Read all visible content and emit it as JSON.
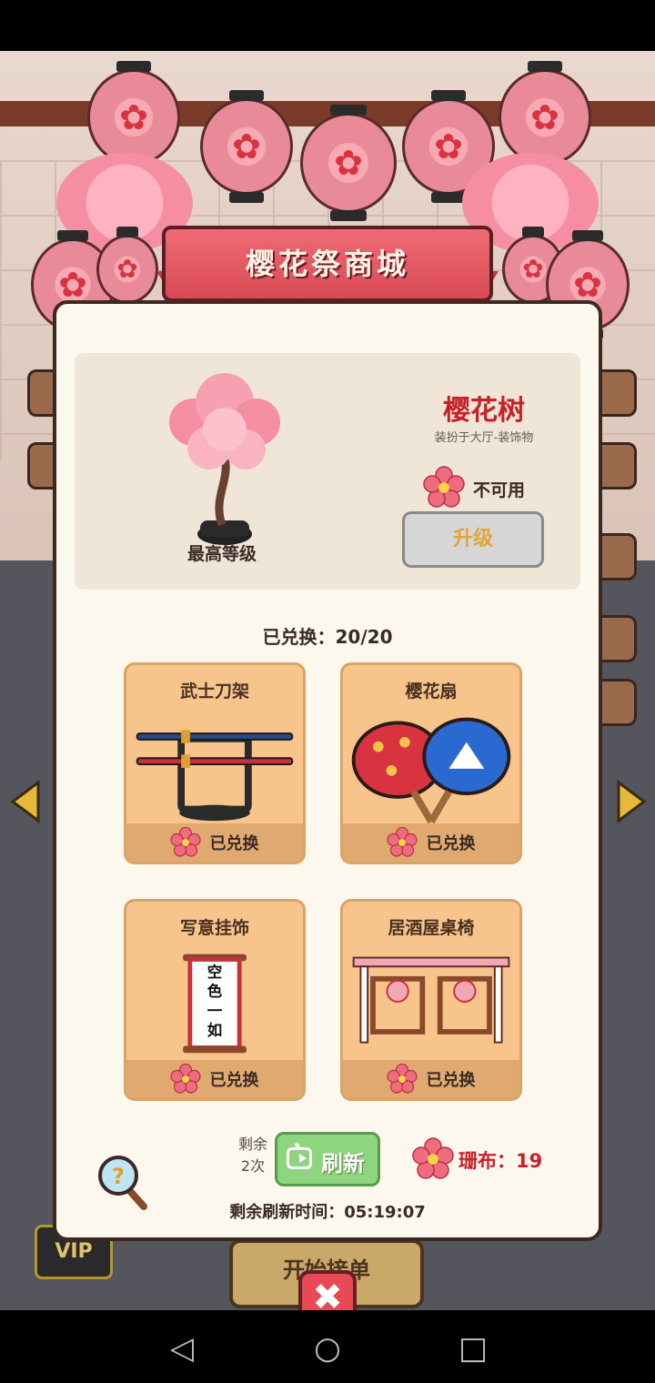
{
  "shop": {
    "title": "樱花祭商城",
    "featured": {
      "name": "樱花树",
      "description": "装扮于大厅-装饰物",
      "level_label": "最高等级",
      "availability": "不可用",
      "upgrade_label": "升级"
    },
    "redeemed_label": "已兑换：20/20",
    "items": [
      {
        "title": "武士刀架",
        "status": "已兑换"
      },
      {
        "title": "樱花扇",
        "status": "已兑换"
      },
      {
        "title": "写意挂饰",
        "status": "已兑换"
      },
      {
        "title": "居酒屋桌椅",
        "status": "已兑换"
      }
    ],
    "scroll_text": "空色一如",
    "refresh": {
      "remaining_label": "剩余",
      "remaining_count": "2次",
      "button_label": "刷新"
    },
    "currency_label": "珊布：19",
    "countdown_label": "剩余刷新时间：05:19:07",
    "close_symbol": "✖"
  },
  "background": {
    "start_button_label": "开始接单",
    "vip_label": "VIP"
  },
  "nav": {
    "back_symbol": "◁",
    "home_symbol": "○",
    "recent_symbol": "□"
  },
  "colors": {
    "panel_bg": "#fdf8ee",
    "card_bg": "#f7c58c",
    "accent_red": "#c8202a",
    "refresh_green": "#8fd47e"
  }
}
